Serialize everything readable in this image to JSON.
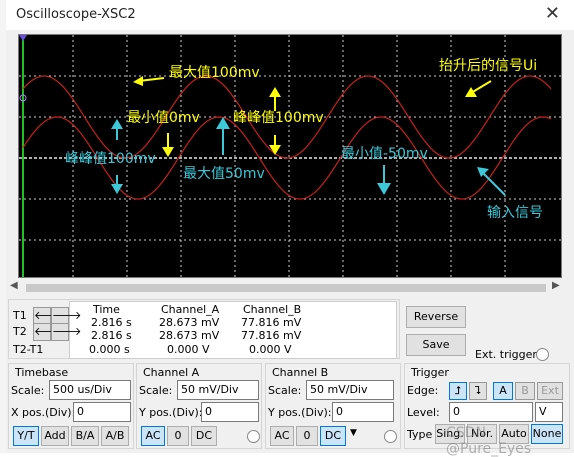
{
  "window": {
    "title": "Oscilloscope-XSC2",
    "close_icon": "close-icon"
  },
  "annotations": {
    "max_100": "最大值100mv",
    "min_0": "最小值0mv",
    "p2p_100_right": "峰峰值100mv",
    "raised_signal": "抬升后的信号Ui",
    "p2p_100_left": "峰峰值100mv",
    "max_50": "最大值50mv",
    "min_neg50": "最小值-50mv",
    "input_signal": "输入信号"
  },
  "readout": {
    "headers": [
      "Time",
      "Channel_A",
      "Channel_B"
    ],
    "rows": [
      {
        "label": "T1",
        "time": "2.816 s",
        "a": "28.673 mV",
        "b": "77.816 mV"
      },
      {
        "label": "T2",
        "time": "2.816 s",
        "a": "28.673 mV",
        "b": "77.816 mV"
      },
      {
        "label": "T2-T1",
        "time": "0.000 s",
        "a": "0.000 V",
        "b": "0.000 V"
      }
    ]
  },
  "buttons": {
    "reverse": "Reverse",
    "save": "Save",
    "ext_trigger": "Ext. trigger"
  },
  "timebase": {
    "title": "Timebase",
    "scale_label": "Scale:",
    "scale": "500 us/Div",
    "xpos_label": "X pos.(Div):",
    "xpos": "0",
    "modes": [
      "Y/T",
      "Add",
      "B/A",
      "A/B"
    ],
    "active_mode": "Y/T"
  },
  "channel_a": {
    "title": "Channel A",
    "scale_label": "Scale:",
    "scale": "50 mV/Div",
    "ypos_label": "Y pos.(Div):",
    "ypos": "0",
    "coupling": [
      "AC",
      "0",
      "DC"
    ],
    "active": "AC"
  },
  "channel_b": {
    "title": "Channel B",
    "scale_label": "Scale:",
    "scale": "50 mV/Div",
    "ypos_label": "Y pos.(Div):",
    "ypos": "0",
    "coupling": [
      "AC",
      "0",
      "DC"
    ],
    "active": "DC"
  },
  "trigger": {
    "title": "Trigger",
    "edge_label": "Edge:",
    "level_label": "Level:",
    "level": "0",
    "level_unit": "V",
    "sources": [
      "A",
      "B",
      "Ext"
    ],
    "active_source": "A",
    "type_label": "Type",
    "types": [
      "Sing.",
      "Nor.",
      "Auto",
      "None"
    ],
    "active_type": "None"
  },
  "watermark": "CSDN @Pure_Eyes",
  "colors": {
    "trace": "#c8201c",
    "grid": "#d0d0d0",
    "yellow_annot": "#ffff00",
    "cyan_annot": "#3cc8d8"
  }
}
